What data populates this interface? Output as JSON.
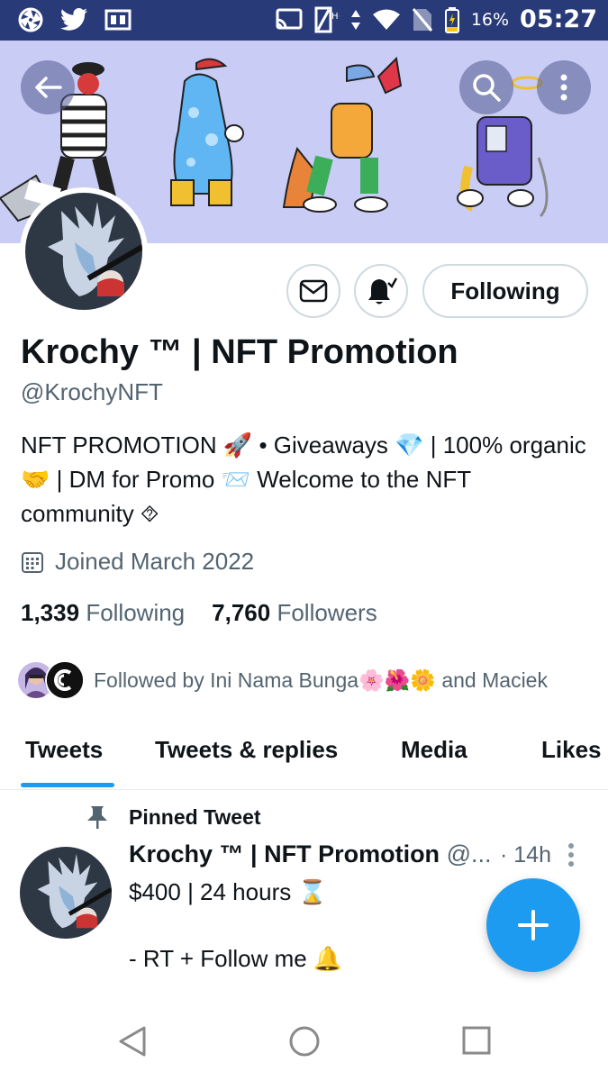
{
  "status_bar": {
    "battery_percent": "16%",
    "time": "05:27"
  },
  "profile": {
    "display_name": "Krochy ™ | NFT Promotion",
    "handle": "@KrochyNFT",
    "bio": "NFT PROMOTION 🚀 • Giveaways 💎 | 100% organic🤝 | DM for Promo 📨 Welcome to the NFT community ⯑",
    "joined": "Joined March 2022",
    "following_count": "1,339",
    "following_label": "Following",
    "followers_count": "7,760",
    "followers_label": "Followers",
    "followed_by": "Followed by Ini Nama Bunga🌸🌺🌼 and Maciek",
    "following_button": "Following"
  },
  "tabs": [
    "Tweets",
    "Tweets & replies",
    "Media",
    "Likes"
  ],
  "active_tab": "Tweets",
  "tweet": {
    "pinned_label": "Pinned Tweet",
    "author_name": "Krochy ™ | NFT Promotion",
    "author_handle_truncated": "@...",
    "time": "· 14h",
    "line1": "$400 | 24 hours ⌛",
    "line2": "- RT + Follow me 🔔"
  },
  "colors": {
    "status_bar_bg": "#283a78",
    "banner_bg": "#c9cdf6",
    "accent": "#1d9bf0"
  },
  "icons": [
    "aperture-icon",
    "twitter-bird-icon",
    "book-icon",
    "cast-icon",
    "signal-icon",
    "data-arrows-icon",
    "wifi-icon",
    "no-sim-icon",
    "battery-icon",
    "back-arrow-icon",
    "search-icon",
    "more-vertical-icon",
    "mail-icon",
    "bell-check-icon",
    "calendar-icon",
    "pin-icon",
    "compose-plus-icon",
    "nav-back-icon",
    "nav-home-icon",
    "nav-recents-icon"
  ]
}
